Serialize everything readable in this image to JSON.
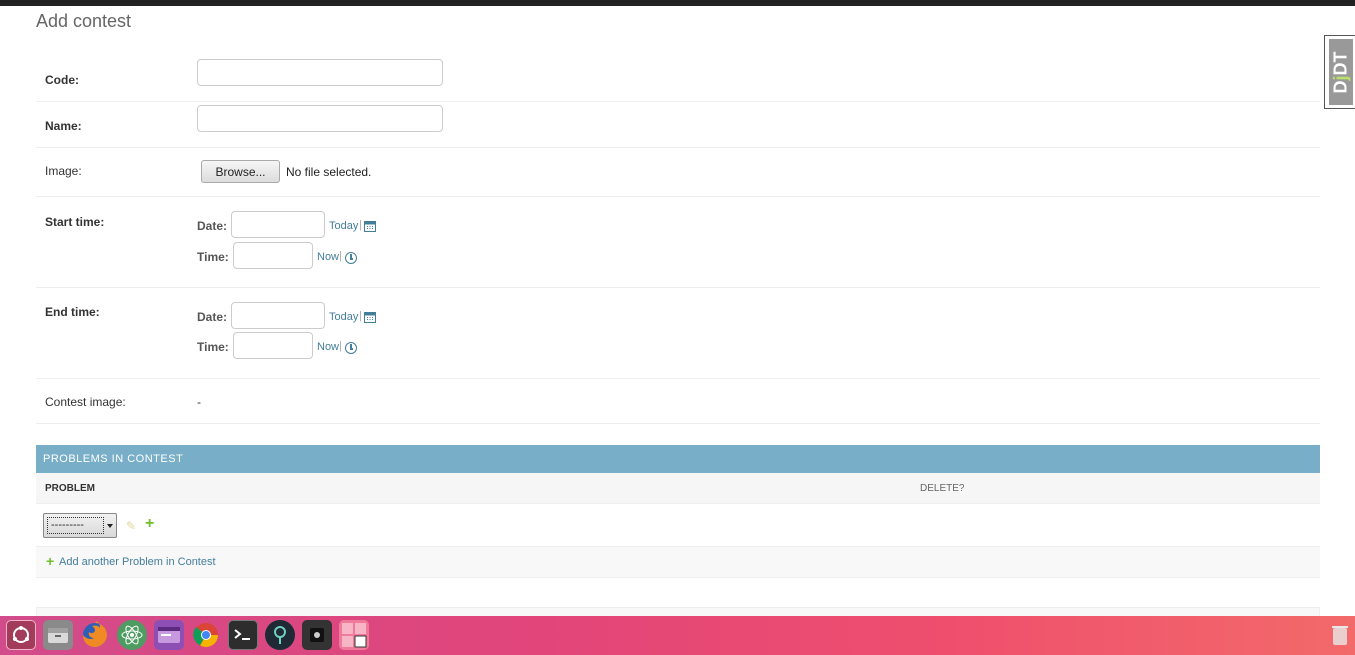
{
  "page": {
    "title": "Add contest"
  },
  "fields": {
    "code": {
      "label": "Code:",
      "value": ""
    },
    "name": {
      "label": "Name:",
      "value": ""
    },
    "image": {
      "label": "Image:",
      "browse_label": "Browse...",
      "status": "No file selected."
    },
    "start_time": {
      "label": "Start time:",
      "date_label": "Date:",
      "date_value": "",
      "today_label": "Today",
      "time_label": "Time:",
      "time_value": "",
      "now_label": "Now",
      "separator": "|"
    },
    "end_time": {
      "label": "End time:",
      "date_label": "Date:",
      "date_value": "",
      "today_label": "Today",
      "time_label": "Time:",
      "time_value": "",
      "now_label": "Now",
      "separator": "|"
    },
    "contest_image": {
      "label": "Contest image:",
      "value": "-"
    }
  },
  "inline": {
    "header": "PROBLEMS IN CONTEST",
    "columns": {
      "problem": "PROBLEM",
      "delete": "DELETE?"
    },
    "row": {
      "select_value": "---------"
    },
    "add_another": "Add another Problem in Contest"
  },
  "toolbar": {
    "djdt_label": "DJDT",
    "djdt_prefix": "D",
    "djdt_accent": "j",
    "djdt_suffix": "DT"
  },
  "taskbar": {
    "items": [
      "ubuntu-dash",
      "files",
      "firefox",
      "atom",
      "app",
      "chrome",
      "terminal",
      "keepassxc",
      "app-dark",
      "workspace-switcher"
    ]
  },
  "colors": {
    "accent": "#79aec8",
    "link": "#447e9b",
    "add": "#70bf2b"
  }
}
